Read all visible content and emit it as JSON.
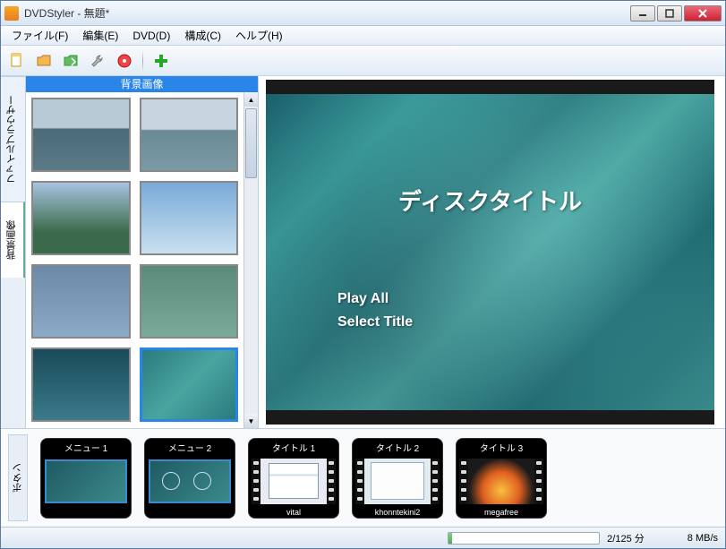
{
  "titlebar": {
    "text": "DVDStyler - 無題*"
  },
  "menubar": {
    "file": "ファイル(F)",
    "edit": "編集(E)",
    "dvd": "DVD(D)",
    "config": "構成(C)",
    "help": "ヘルプ(H)"
  },
  "toolbar_icons": {
    "new": "new-document-icon",
    "open": "open-folder-icon",
    "save": "save-icon",
    "settings": "wrench-icon",
    "burn": "burn-disc-icon",
    "add": "plus-icon"
  },
  "side_tabs": {
    "file_browser": "ファイルブラウザー",
    "background_images": "背景画像",
    "buttons": "ボタン"
  },
  "bg_panel": {
    "header": "背景画像"
  },
  "preview": {
    "title": "ディスクタイトル",
    "play_all": "Play All",
    "select_title": "Select Title"
  },
  "timeline": {
    "items": [
      {
        "label": "メニュー 1",
        "footer": "",
        "type": "menu",
        "bg": "tl-menu1-bg"
      },
      {
        "label": "メニュー 2",
        "footer": "",
        "type": "menu",
        "bg": "tl-menu2-bg"
      },
      {
        "label": "タイトル 1",
        "footer": "vital",
        "type": "title",
        "bg": "tl-app1-bg"
      },
      {
        "label": "タイトル 2",
        "footer": "khonntekini2",
        "type": "title",
        "bg": "tl-app2-bg"
      },
      {
        "label": "タイトル 3",
        "footer": "megafree",
        "type": "title",
        "bg": "tl-fire-bg"
      }
    ]
  },
  "statusbar": {
    "duration": "2/125 分",
    "rate": "8 MB/s"
  }
}
